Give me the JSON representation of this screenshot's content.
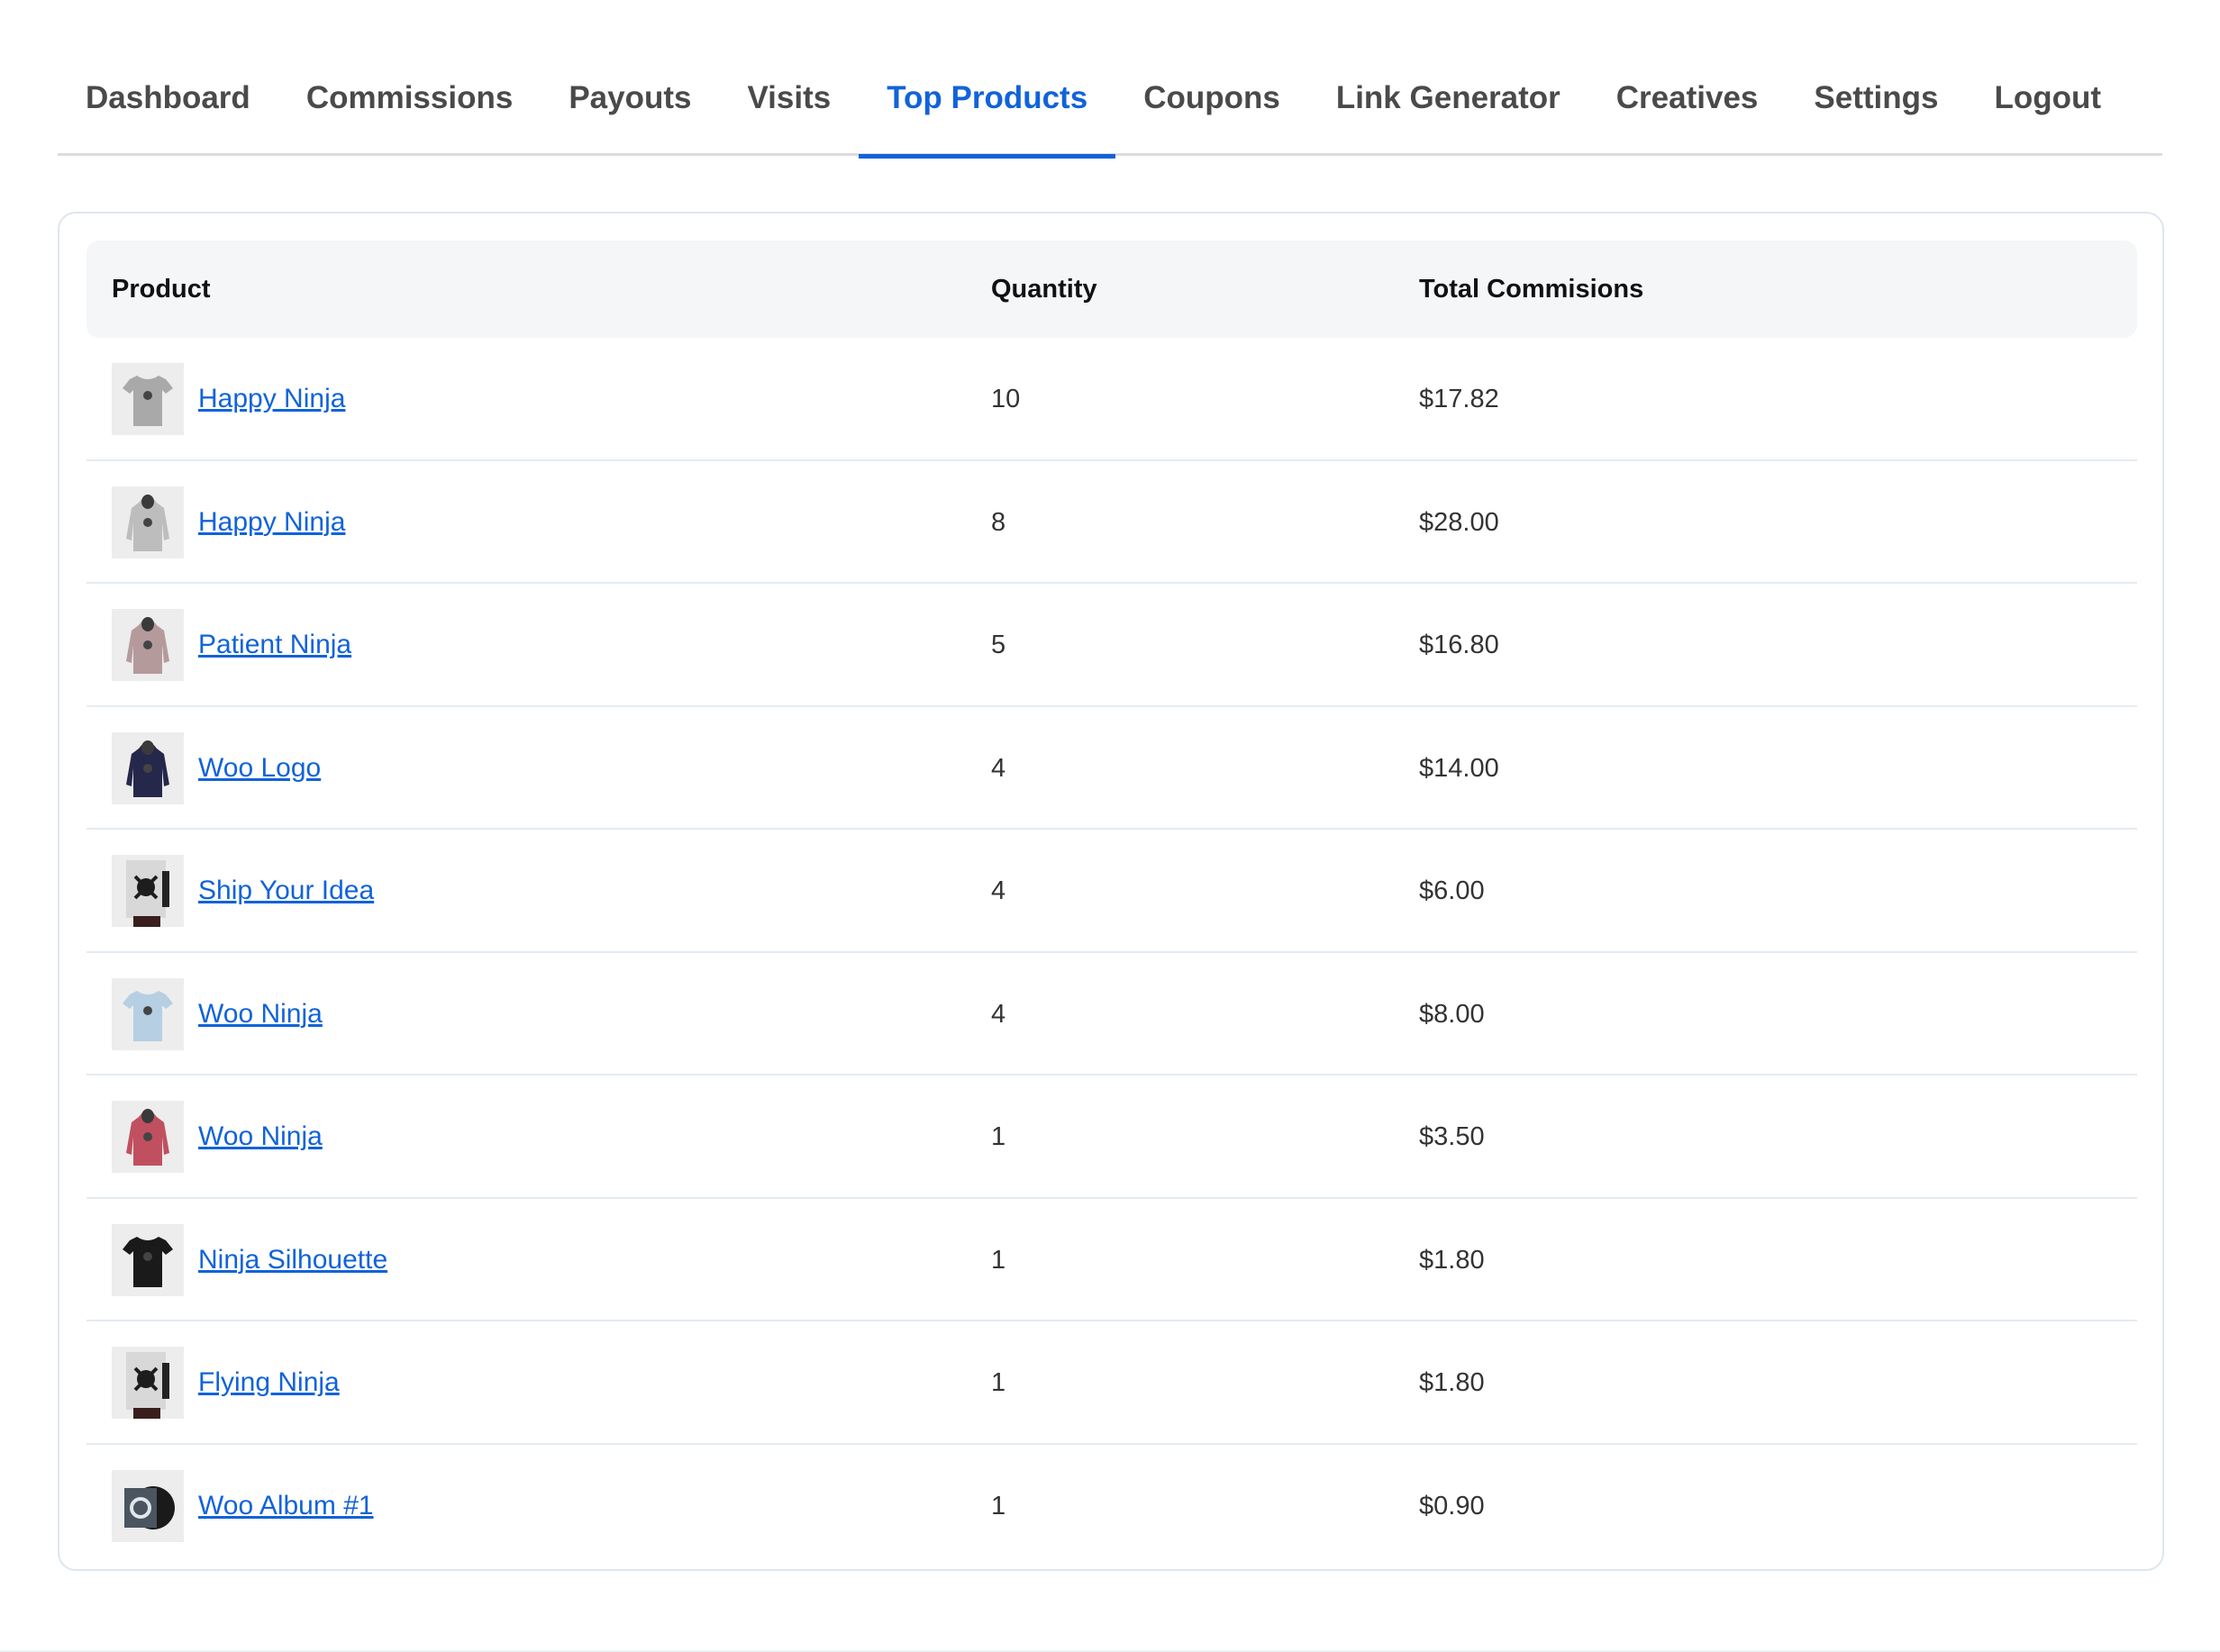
{
  "nav": {
    "tabs": [
      {
        "label": "Dashboard"
      },
      {
        "label": "Commissions"
      },
      {
        "label": "Payouts"
      },
      {
        "label": "Visits"
      },
      {
        "label": "Top Products"
      },
      {
        "label": "Coupons"
      },
      {
        "label": "Link Generator"
      },
      {
        "label": "Creatives"
      },
      {
        "label": "Settings"
      },
      {
        "label": "Logout"
      }
    ],
    "active_tab": "Top Products"
  },
  "table": {
    "headers": {
      "product": "Product",
      "quantity": "Quantity",
      "total": "Total Commisions"
    },
    "rows": [
      {
        "name": "Happy Ninja",
        "qty": "10",
        "total": "$17.82",
        "thumb": "tshirt-icon"
      },
      {
        "name": "Happy Ninja",
        "qty": "8",
        "total": "$28.00",
        "thumb": "hoodie-icon"
      },
      {
        "name": "Patient Ninja",
        "qty": "5",
        "total": "$16.80",
        "thumb": "hoodie-icon"
      },
      {
        "name": "Woo Logo",
        "qty": "4",
        "total": "$14.00",
        "thumb": "hoodie-icon"
      },
      {
        "name": "Ship Your Idea",
        "qty": "4",
        "total": "$6.00",
        "thumb": "poster-icon"
      },
      {
        "name": "Woo Ninja",
        "qty": "4",
        "total": "$8.00",
        "thumb": "tshirt-icon"
      },
      {
        "name": "Woo Ninja",
        "qty": "1",
        "total": "$3.50",
        "thumb": "hoodie-icon"
      },
      {
        "name": "Ninja Silhouette",
        "qty": "1",
        "total": "$1.80",
        "thumb": "tshirt-icon"
      },
      {
        "name": "Flying Ninja",
        "qty": "1",
        "total": "$1.80",
        "thumb": "poster-icon"
      },
      {
        "name": "Woo Album #1",
        "qty": "1",
        "total": "$0.90",
        "thumb": "album-icon"
      }
    ]
  },
  "colors": {
    "accent": "#1163d9",
    "thumb_colors": [
      "#a9a9a9",
      "#bdbdbd",
      "#b59a9c",
      "#25284a",
      "#d8d8d8",
      "#b6cfe3",
      "#c0505f",
      "#1a1a1a",
      "#d8d8d8",
      "#4a5560"
    ]
  }
}
